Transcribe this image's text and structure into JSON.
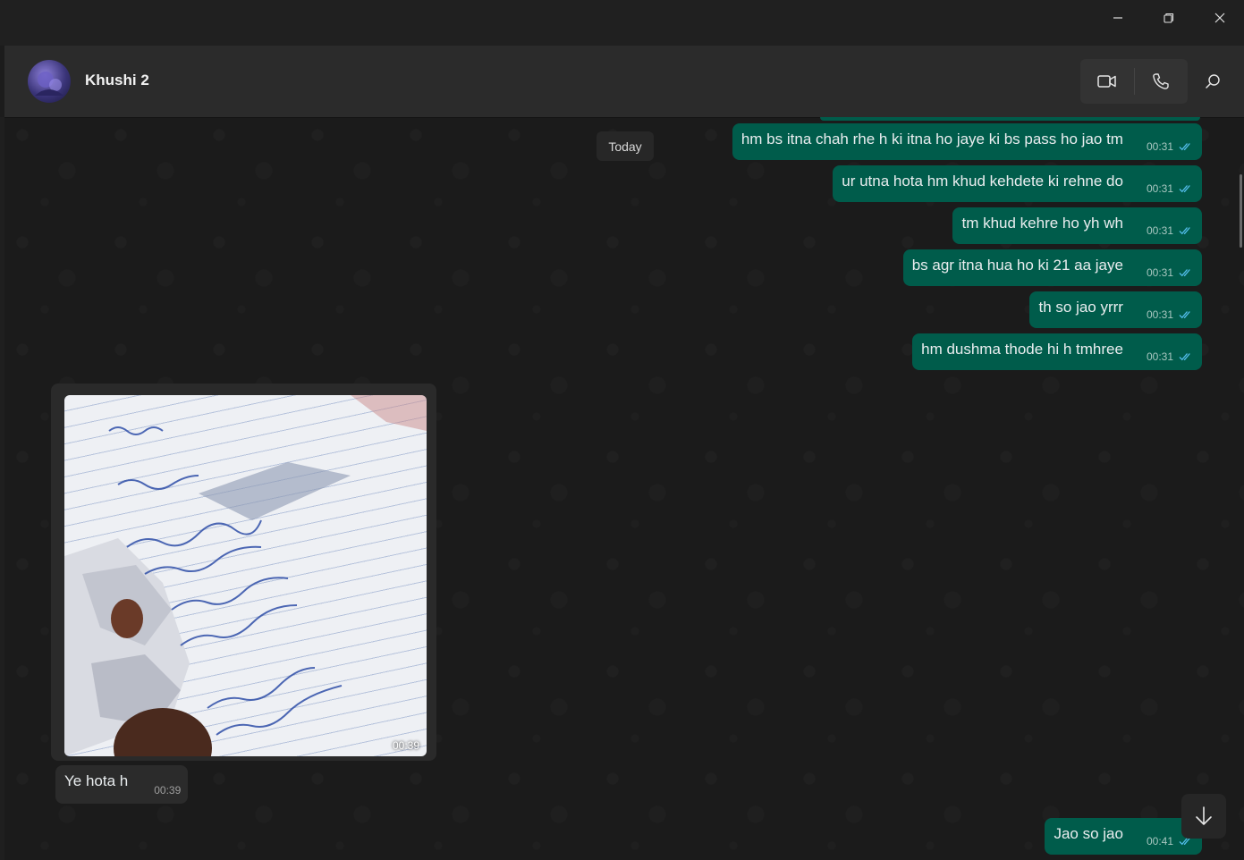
{
  "window": {
    "minimize_icon": "minimize-icon",
    "restore_icon": "restore-icon",
    "close_icon": "close-icon"
  },
  "header": {
    "contact_name": "Khushi 2",
    "video_icon": "video-call-icon",
    "voice_icon": "voice-call-icon",
    "search_icon": "search-icon"
  },
  "chat": {
    "date_separator": "Today",
    "outgoing": [
      {
        "text": "hm bs itna chah rhe h ki itna ho jaye ki bs pass ho jao tm",
        "time": "00:31"
      },
      {
        "text": "ur utna hota hm khud kehdete ki rehne do",
        "time": "00:31"
      },
      {
        "text": "tm khud kehre ho yh wh",
        "time": "00:31"
      },
      {
        "text": "bs agr itna hua ho ki 21 aa jaye",
        "time": "00:31"
      },
      {
        "text": "th so jao yrrr",
        "time": "00:31"
      },
      {
        "text": "hm dushma thode hi h tmhree",
        "time": "00:31"
      }
    ],
    "incoming_image": {
      "time": "00:39"
    },
    "incoming_text": {
      "text": "Ye hota h",
      "time": "00:39"
    },
    "last_outgoing": {
      "text": "Jao so jao",
      "time": "00:41"
    },
    "scroll_down_icon": "arrow-down-icon"
  },
  "colors": {
    "outgoing_bubble": "#005c4b",
    "incoming_bubble": "#2b2b2b",
    "chat_bg": "#1b1b1b",
    "read_ticks": "#53bdeb"
  }
}
